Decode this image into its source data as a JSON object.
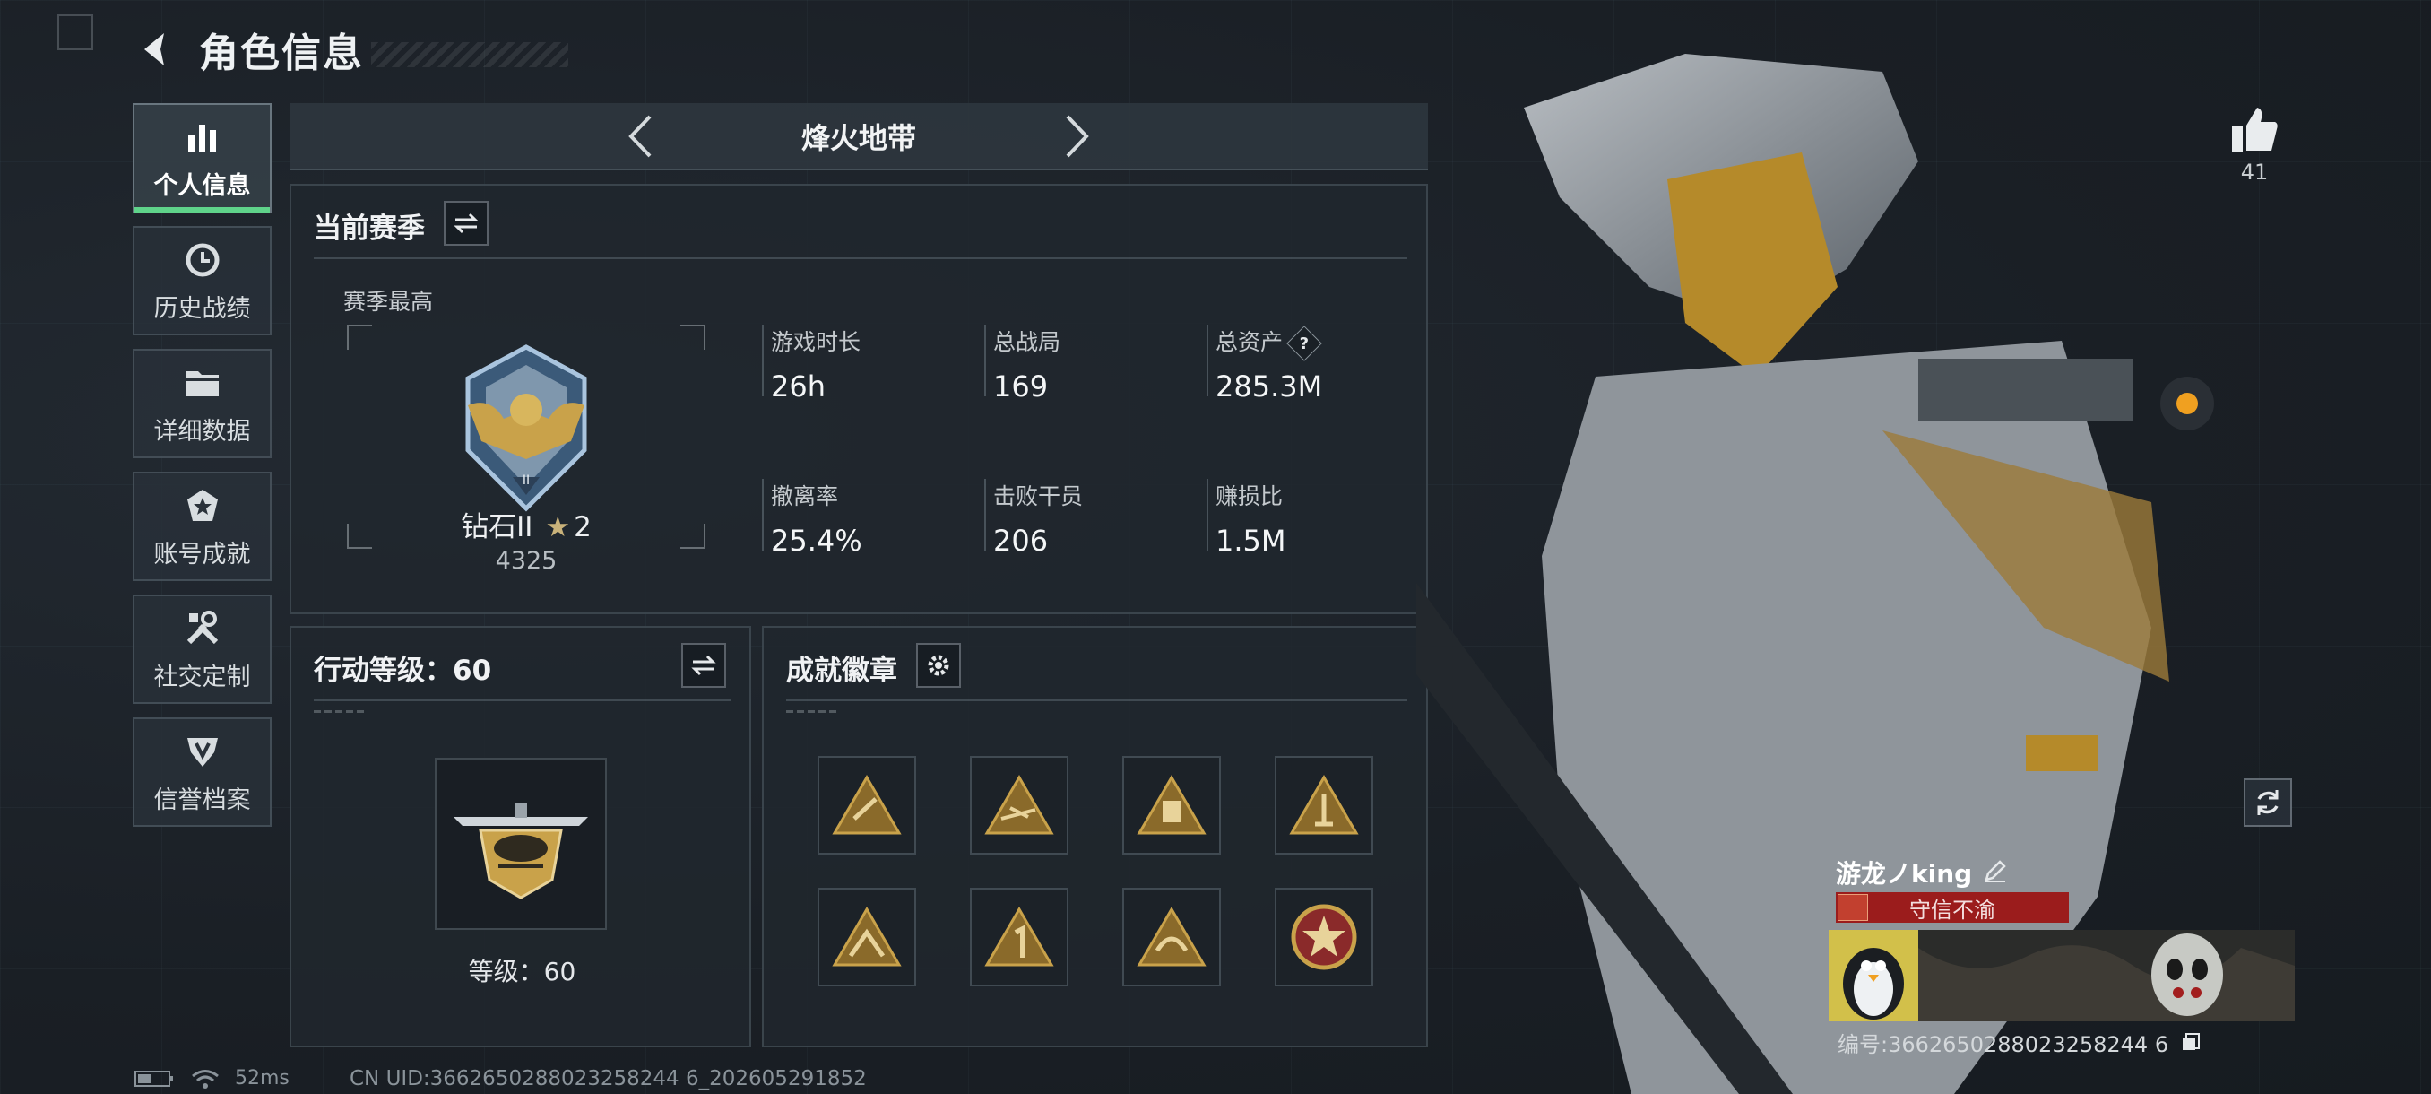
{
  "header": {
    "title": "角色信息"
  },
  "sidebar": {
    "items": [
      {
        "label": "个人信息",
        "icon": "bar-chart-icon",
        "active": true
      },
      {
        "label": "历史战绩",
        "icon": "history-clock-icon"
      },
      {
        "label": "详细数据",
        "icon": "folder-icon"
      },
      {
        "label": "账号成就",
        "icon": "achievement-star-icon"
      },
      {
        "label": "社交定制",
        "icon": "tools-icon"
      },
      {
        "label": "信誉档案",
        "icon": "shield-rank-icon"
      }
    ]
  },
  "mode": {
    "name": "烽火地带"
  },
  "season": {
    "title": "当前赛季",
    "best_label": "赛季最高",
    "rank_name": "钻石II",
    "rank_stars": "2",
    "rank_score": "4325",
    "stats": [
      {
        "label": "游戏时长",
        "value": "26h"
      },
      {
        "label": "总战局",
        "value": "169"
      },
      {
        "label": "总资产",
        "value": "285.3M",
        "help": "?"
      },
      {
        "label": "撤离率",
        "value": "25.4%"
      },
      {
        "label": "击败干员",
        "value": "206"
      },
      {
        "label": "赚损比",
        "value": "1.5M"
      }
    ]
  },
  "action_level": {
    "title": "行动等级：60",
    "level_label": "等级：60"
  },
  "achievements": {
    "title": "成就徽章",
    "badge_count": 8
  },
  "likes": {
    "count": "41"
  },
  "player": {
    "name": "游龙ノking",
    "motto": "守信不渝",
    "id_text": "编号:3662650288023258244 6"
  },
  "status": {
    "ping": "52ms",
    "uid": "CN UID:3662650288023258244 6_202605291852"
  },
  "colors": {
    "accent_green": "#5fd38a",
    "gold": "#c9a24a",
    "motto_red": "#9b1c1c"
  }
}
